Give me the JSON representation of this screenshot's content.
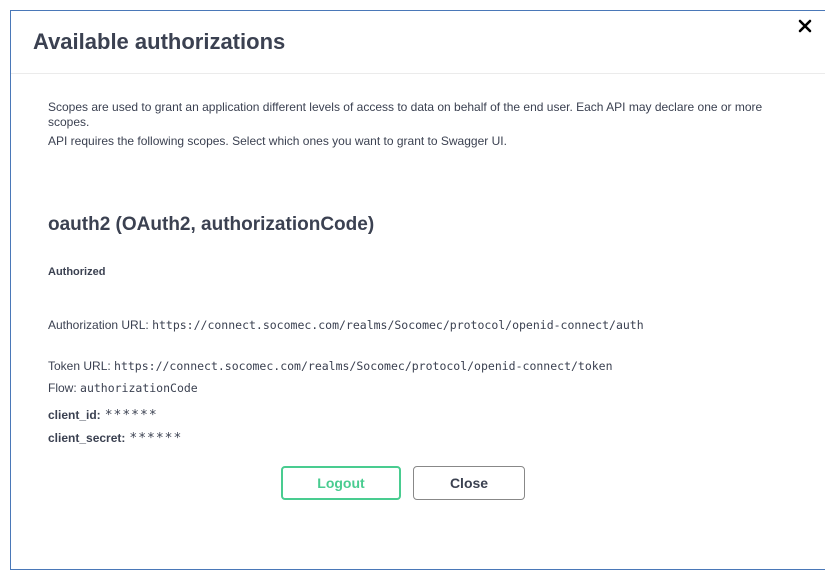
{
  "modal": {
    "title": "Available authorizations",
    "close_icon": "close-icon"
  },
  "description": {
    "line1": "Scopes are used to grant an application different levels of access to data on behalf of the end user. Each API may declare one or more scopes.",
    "line2": "API requires the following scopes. Select which ones you want to grant to Swagger UI."
  },
  "scheme": {
    "title": "oauth2 (OAuth2, authorizationCode)",
    "status": "Authorized",
    "authorization_url_label": "Authorization URL: ",
    "authorization_url": "https://connect.socomec.com/realms/Socomec/protocol/openid-connect/auth",
    "token_url_label": "Token URL: ",
    "token_url": "https://connect.socomec.com/realms/Socomec/protocol/openid-connect/token",
    "flow_label": "Flow: ",
    "flow": "authorizationCode",
    "client_id_label": "client_id:",
    "client_id_value": "******",
    "client_secret_label": "client_secret:",
    "client_secret_value": "******"
  },
  "buttons": {
    "logout": "Logout",
    "close": "Close"
  },
  "colors": {
    "accent_green": "#49cc90",
    "text": "#3b4151",
    "border_blue": "#4a78b8"
  }
}
